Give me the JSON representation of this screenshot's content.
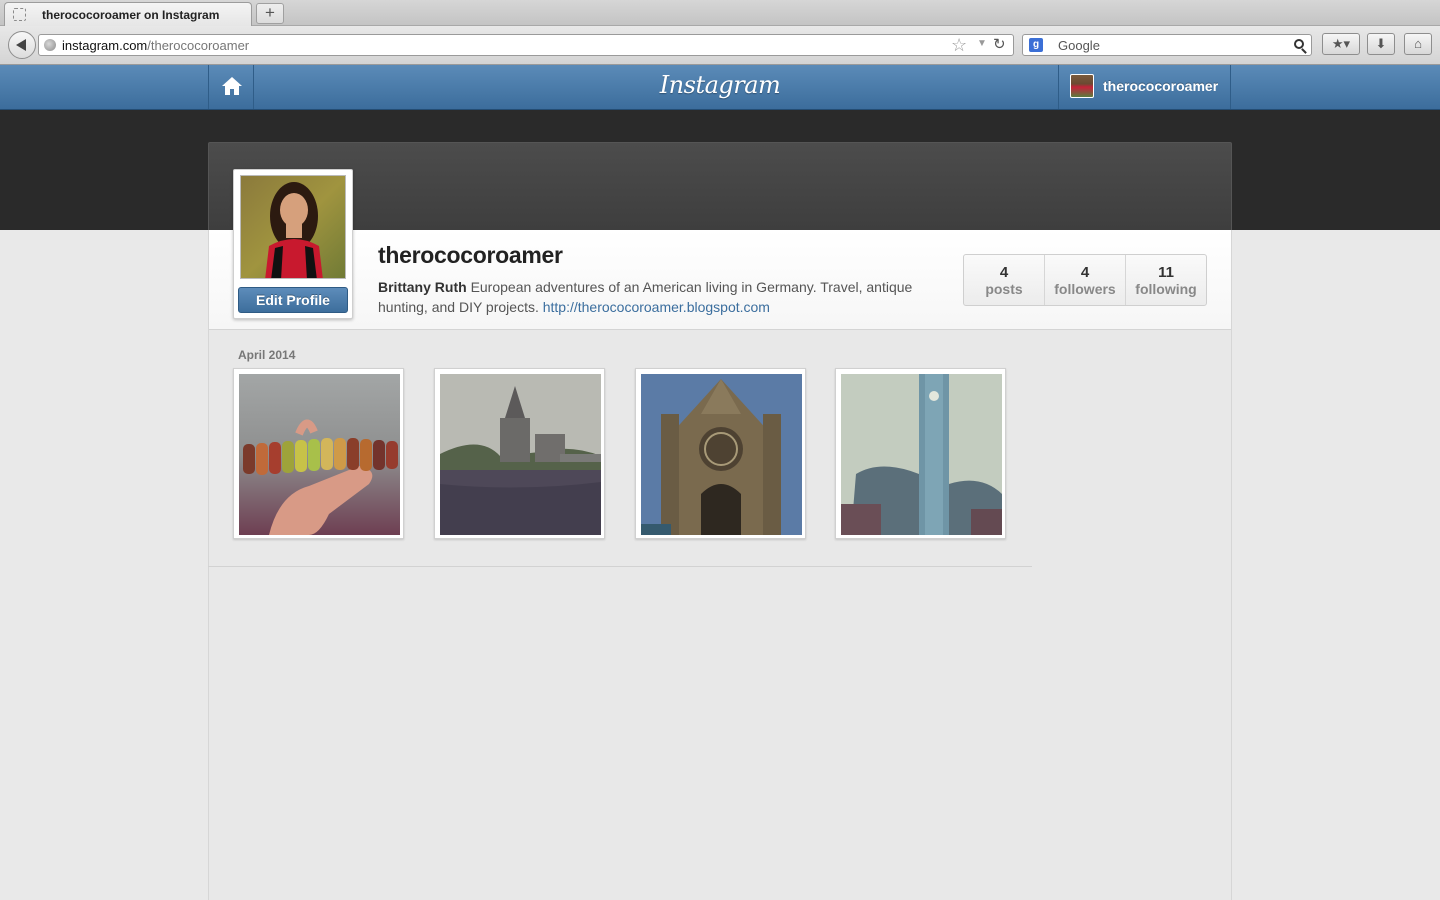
{
  "browser": {
    "tab_title": "therococoroamer on Instagram",
    "new_tab_label": "+",
    "url_domain": "instagram.com",
    "url_path": "/therococoroamer",
    "search_placeholder": "Google"
  },
  "header": {
    "logo": "Instagram",
    "username": "therococoroamer"
  },
  "profile": {
    "username": "therococoroamer",
    "full_name": "Brittany Ruth",
    "bio": "European adventures of an American living in Germany. Travel, antique hunting, and DIY projects.",
    "website": "http://therococoroamer.blogspot.com",
    "edit_label": "Edit Profile",
    "stats": [
      {
        "value": "4",
        "label": "posts"
      },
      {
        "value": "4",
        "label": "followers"
      },
      {
        "value": "11",
        "label": "following"
      }
    ]
  },
  "feed": {
    "month": "April 2014",
    "photos": [
      {
        "subject": "macarons-on-hand"
      },
      {
        "subject": "church-by-river"
      },
      {
        "subject": "gothic-cathedral"
      },
      {
        "subject": "blue-church-tower"
      }
    ]
  },
  "colors": {
    "header_blue": "#3c6d9c",
    "link_blue": "#3b6e9e",
    "dark_band": "#2a2a2a"
  }
}
